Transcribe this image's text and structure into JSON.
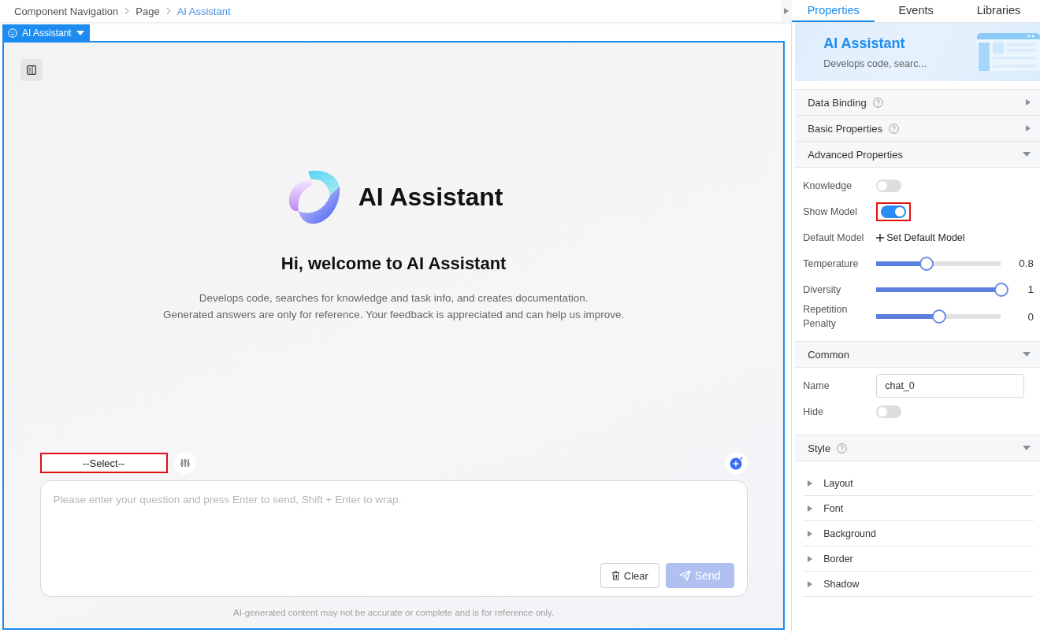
{
  "breadcrumb": [
    {
      "label": "Component Navigation",
      "current": false
    },
    {
      "label": "Page",
      "current": false
    },
    {
      "label": "AI Assistant",
      "current": true
    }
  ],
  "component_tag": {
    "label": "AI Assistant"
  },
  "canvas": {
    "title": "AI Assistant",
    "heading": "Hi, welcome to AI Assistant",
    "description": [
      "Develops code, searches for knowledge and task info, and creates documentation.",
      "Generated answers are only for reference. Your feedback is appreciated and can help us improve."
    ],
    "model_select": {
      "value": "--Select--",
      "highlighted": true
    },
    "input": {
      "placeholder": "Please enter your question and press Enter to send, Shift + Enter to wrap."
    },
    "buttons": [
      {
        "label": "Clear",
        "kind": "clear",
        "disabled": false
      },
      {
        "label": "Send",
        "kind": "send",
        "disabled": true
      }
    ],
    "disclaimer": "AI-generated content may not be accurate or complete and is for reference only."
  },
  "panel": {
    "tabs": [
      {
        "label": "Properties",
        "selected": true
      },
      {
        "label": "Events",
        "selected": false
      },
      {
        "label": "Libraries",
        "selected": false
      }
    ],
    "header": {
      "title": "AI Assistant",
      "description": "Develops code, searc..."
    },
    "sections": [
      {
        "title": "Data Binding",
        "help": true,
        "expanded": false
      },
      {
        "title": "Basic Properties",
        "help": true,
        "expanded": false
      },
      {
        "title": "Advanced Properties",
        "help": false,
        "expanded": true,
        "fields": [
          {
            "kind": "toggle",
            "label": "Knowledge",
            "on": false,
            "highlighted": false
          },
          {
            "kind": "toggle",
            "label": "Show Model",
            "on": true,
            "highlighted": true
          },
          {
            "kind": "link",
            "label": "Default Model",
            "value": "Set Default Model"
          },
          {
            "kind": "slider",
            "label": "Temperature",
            "level": 0.4,
            "reading": "0.8"
          },
          {
            "kind": "slider",
            "label": "Diversity",
            "level": 1,
            "reading": "1"
          },
          {
            "kind": "slider",
            "label": "Repetition Penalty",
            "level": 0.5,
            "reading": "0"
          }
        ]
      },
      {
        "title": "Common",
        "help": false,
        "expanded": true,
        "fields": [
          {
            "kind": "input",
            "label": "Name",
            "value": "chat_0"
          },
          {
            "kind": "toggle",
            "label": "Hide",
            "on": false,
            "highlighted": false
          }
        ]
      },
      {
        "title": "Style",
        "help": true,
        "expanded": true,
        "groups": [
          {
            "label": "Layout",
            "expanded": false
          },
          {
            "label": "Font",
            "expanded": false
          },
          {
            "label": "Background",
            "expanded": false
          },
          {
            "label": "Border",
            "expanded": false
          },
          {
            "label": "Shadow",
            "expanded": false
          }
        ]
      }
    ]
  }
}
